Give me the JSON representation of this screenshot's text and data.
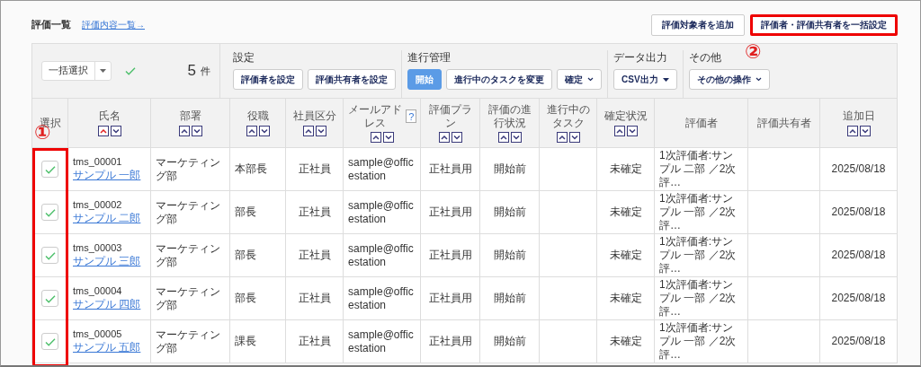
{
  "title": "評価一覧",
  "title_link": "評価内容一覧→",
  "top_buttons": [
    {
      "label": "評価対象者を追加",
      "highlighted": false
    },
    {
      "label": "評価者・評価共有者を一括設定",
      "highlighted": true
    }
  ],
  "toolbar": {
    "bulk_select": "一括選択",
    "all_checked": true,
    "count": "5",
    "count_unit": "件",
    "groups": [
      {
        "label": "設定",
        "buttons": [
          {
            "label": "評価者を設定",
            "kind": "default"
          },
          {
            "label": "評価共有者を設定",
            "kind": "default"
          }
        ]
      },
      {
        "label": "進行管理",
        "buttons": [
          {
            "label": "開始",
            "kind": "primary"
          },
          {
            "label": "進行中のタスクを変更",
            "kind": "default"
          },
          {
            "label": "確定",
            "kind": "chevron"
          }
        ]
      },
      {
        "label": "データ出力",
        "buttons": [
          {
            "label": "CSV出力",
            "kind": "triangle"
          }
        ]
      },
      {
        "label": "その他",
        "buttons": [
          {
            "label": "その他の操作",
            "kind": "chevron"
          }
        ]
      }
    ]
  },
  "table": {
    "columns": [
      {
        "label": "選択",
        "sortable": false
      },
      {
        "label": "氏名",
        "sortable": true,
        "sort_asc": true
      },
      {
        "label": "部署",
        "sortable": true,
        "sort_asc": false
      },
      {
        "label": "役職",
        "sortable": true,
        "sort_asc": false
      },
      {
        "label": "社員区分",
        "sortable": true,
        "sort_asc": false
      },
      {
        "label": "メールアドレス",
        "sortable": true,
        "sort_asc": false,
        "help": "?"
      },
      {
        "label": "評価プラン",
        "sortable": true,
        "sort_asc": false
      },
      {
        "label": "評価の進行状況",
        "sortable": true,
        "sort_asc": false
      },
      {
        "label": "進行中のタスク",
        "sortable": true,
        "sort_asc": false
      },
      {
        "label": "確定状況",
        "sortable": true,
        "sort_asc": false
      },
      {
        "label": "評価者",
        "sortable": false
      },
      {
        "label": "評価共有者",
        "sortable": false
      },
      {
        "label": "追加日",
        "sortable": true,
        "sort_asc": false
      }
    ],
    "rows": [
      {
        "checked": true,
        "id": "tms_00001",
        "name": "サンプル 一郎",
        "department": "マーケティング部",
        "position": "本部長",
        "type": "正社員",
        "email": "sample@officestation",
        "plan": "正社員用",
        "progress": "開始前",
        "confirm": "未確定",
        "evaluator": "1次評価者:サンプル 二部 ／2次評…",
        "date": "2025/08/18"
      },
      {
        "checked": true,
        "id": "tms_00002",
        "name": "サンプル 二郎",
        "department": "マーケティング部",
        "position": "部長",
        "type": "正社員",
        "email": "sample@officestation",
        "plan": "正社員用",
        "progress": "開始前",
        "confirm": "未確定",
        "evaluator": "1次評価者:サンプル 一部 ／2次評…",
        "date": "2025/08/18"
      },
      {
        "checked": true,
        "id": "tms_00003",
        "name": "サンプル 三郎",
        "department": "マーケティング部",
        "position": "部長",
        "type": "正社員",
        "email": "sample@officestation",
        "plan": "正社員用",
        "progress": "開始前",
        "confirm": "未確定",
        "evaluator": "1次評価者:サンプル 一部 ／2次評…",
        "date": "2025/08/18"
      },
      {
        "checked": true,
        "id": "tms_00004",
        "name": "サンプル 四郎",
        "department": "マーケティング部",
        "position": "部長",
        "type": "正社員",
        "email": "sample@officestation",
        "plan": "正社員用",
        "progress": "開始前",
        "confirm": "未確定",
        "evaluator": "1次評価者:サンプル 一部 ／2次評…",
        "date": "2025/08/18"
      },
      {
        "checked": true,
        "id": "tms_00005",
        "name": "サンプル 五郎",
        "department": "マーケティング部",
        "position": "課長",
        "type": "正社員",
        "email": "sample@officestation",
        "plan": "正社員用",
        "progress": "開始前",
        "confirm": "未確定",
        "evaluator": "1次評価者:サンプル 一部 ／2次評…",
        "date": "2025/08/18"
      }
    ]
  },
  "annotations": [
    {
      "kind": "column",
      "text": "①"
    },
    {
      "kind": "button",
      "text": "②"
    }
  ]
}
